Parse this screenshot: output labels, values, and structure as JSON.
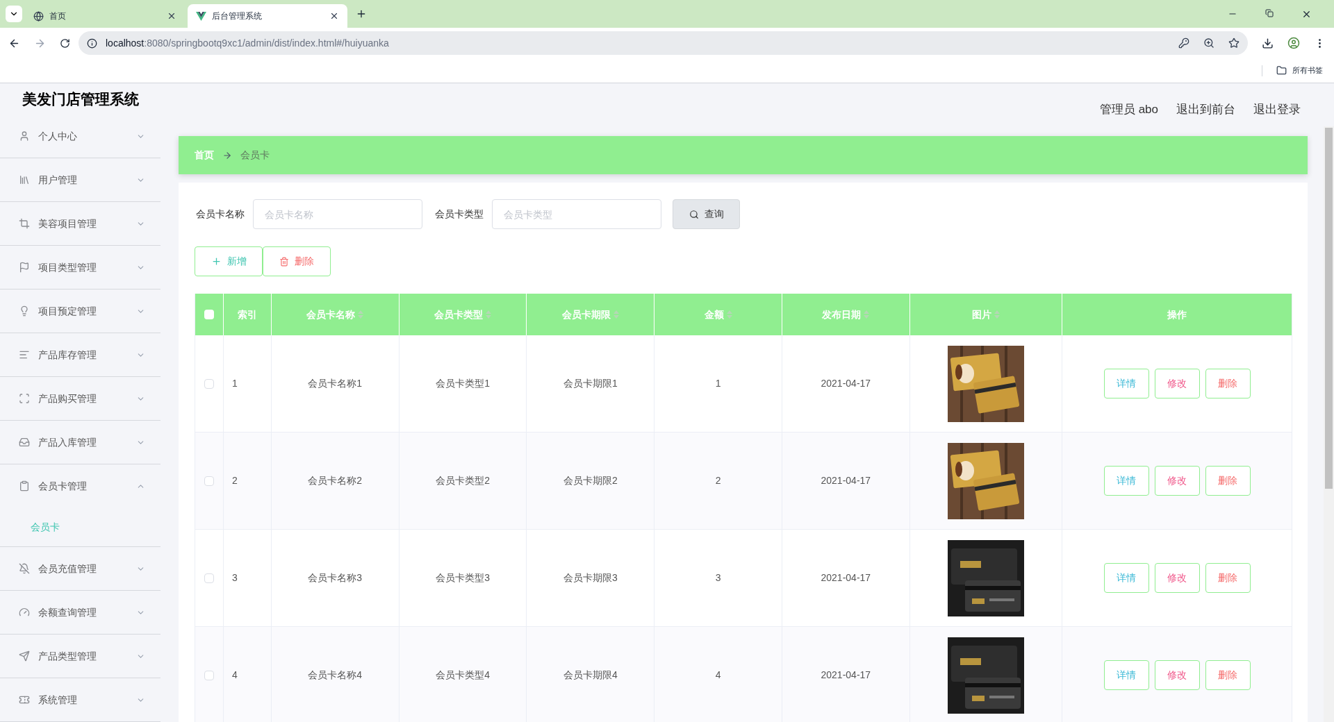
{
  "browser": {
    "tabs": [
      {
        "title": "首页",
        "selected": false
      },
      {
        "title": "后台管理系统",
        "selected": true
      }
    ],
    "url": {
      "host": "localhost",
      "rest": ":8080/springbootq9xc1/admin/dist/index.html#/huiyuanka"
    },
    "bookmarks_label": "所有书签"
  },
  "app_title": "美发门店管理系统",
  "header_links": [
    "管理员 abo",
    "退出到前台",
    "退出登录"
  ],
  "sidebar": {
    "items": [
      {
        "label": "个人中心",
        "expanded": false
      },
      {
        "label": "用户管理",
        "expanded": false
      },
      {
        "label": "美容项目管理",
        "expanded": false
      },
      {
        "label": "项目类型管理",
        "expanded": false
      },
      {
        "label": "项目预定管理",
        "expanded": false
      },
      {
        "label": "产品库存管理",
        "expanded": false
      },
      {
        "label": "产品购买管理",
        "expanded": false
      },
      {
        "label": "产品入库管理",
        "expanded": false
      },
      {
        "label": "会员卡管理",
        "expanded": true,
        "children": [
          {
            "label": "会员卡",
            "selected": true
          }
        ]
      },
      {
        "label": "会员充值管理",
        "expanded": false
      },
      {
        "label": "余额查询管理",
        "expanded": false
      },
      {
        "label": "产品类型管理",
        "expanded": false
      },
      {
        "label": "系统管理",
        "expanded": false
      }
    ]
  },
  "breadcrumb": [
    "首页",
    "会员卡"
  ],
  "search": {
    "fields": [
      {
        "label": "会员卡名称",
        "placeholder": "会员卡名称"
      },
      {
        "label": "会员卡类型",
        "placeholder": "会员卡类型"
      }
    ],
    "button": "查询"
  },
  "actions": [
    {
      "label": "新增",
      "kind": "add"
    },
    {
      "label": "删除",
      "kind": "delete"
    }
  ],
  "table": {
    "header_checkbox": {
      "checked": false
    },
    "columns": [
      {
        "label": "索引",
        "sortable": false
      },
      {
        "label": "会员卡名称",
        "sortable": true
      },
      {
        "label": "会员卡类型",
        "sortable": true
      },
      {
        "label": "会员卡期限",
        "sortable": true
      },
      {
        "label": "金额",
        "sortable": true
      },
      {
        "label": "发布日期",
        "sortable": true
      },
      {
        "label": "图片",
        "sortable": true
      },
      {
        "label": "操作",
        "sortable": false
      }
    ],
    "rows": [
      {
        "checked": false,
        "cells": [
          "1",
          "会员卡名称1",
          "会员卡类型1",
          "会员卡期限1",
          "1",
          "2021-04-17"
        ],
        "image": {
          "kind": "picture"
        },
        "buttons": [
          {
            "label": "详情",
            "kind": "detail"
          },
          {
            "label": "修改",
            "kind": "edit"
          },
          {
            "label": "删除",
            "kind": "delete"
          }
        ]
      },
      {
        "checked": false,
        "cells": [
          "2",
          "会员卡名称2",
          "会员卡类型2",
          "会员卡期限2",
          "2",
          "2021-04-17"
        ],
        "image": {
          "kind": "picture"
        },
        "buttons": [
          {
            "label": "详情",
            "kind": "detail"
          },
          {
            "label": "修改",
            "kind": "edit"
          },
          {
            "label": "删除",
            "kind": "delete"
          }
        ]
      },
      {
        "checked": false,
        "cells": [
          "3",
          "会员卡名称3",
          "会员卡类型3",
          "会员卡期限3",
          "3",
          "2021-04-17"
        ],
        "image": {
          "kind": "picture"
        },
        "buttons": [
          {
            "label": "详情",
            "kind": "detail"
          },
          {
            "label": "修改",
            "kind": "edit"
          },
          {
            "label": "删除",
            "kind": "delete"
          }
        ]
      },
      {
        "checked": false,
        "cells": [
          "4",
          "会员卡名称4",
          "会员卡类型4",
          "会员卡期限4",
          "4",
          "2021-04-17"
        ],
        "image": {
          "kind": "picture"
        },
        "buttons": [
          {
            "label": "详情",
            "kind": "detail"
          },
          {
            "label": "修改",
            "kind": "edit"
          },
          {
            "label": "删除",
            "kind": "delete"
          }
        ]
      }
    ]
  }
}
